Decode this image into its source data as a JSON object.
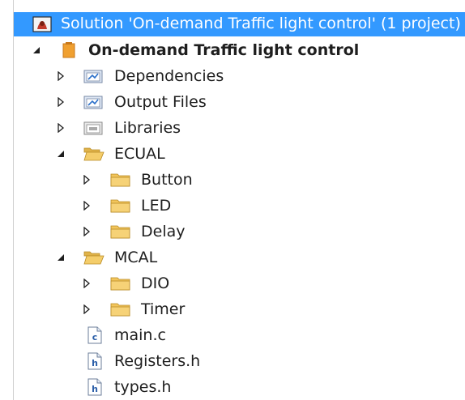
{
  "tree": {
    "solution": {
      "label": "Solution 'On-demand Traffic light control' (1 project)",
      "icon": "solution-icon",
      "selected": true
    },
    "project": {
      "label": "On-demand Traffic light control",
      "icon": "project-icon",
      "expanded": true
    },
    "items": [
      {
        "label": "Dependencies",
        "icon": "reference-folder-icon",
        "expanded": false
      },
      {
        "label": "Output Files",
        "icon": "reference-folder-icon",
        "expanded": false
      },
      {
        "label": "Libraries",
        "icon": "library-folder-icon",
        "expanded": false
      },
      {
        "label": "ECUAL",
        "icon": "folder-open-icon",
        "expanded": true,
        "children": [
          {
            "label": "Button",
            "icon": "folder-icon",
            "expanded": false
          },
          {
            "label": "LED",
            "icon": "folder-icon",
            "expanded": false
          },
          {
            "label": "Delay",
            "icon": "folder-icon",
            "expanded": false
          }
        ]
      },
      {
        "label": "MCAL",
        "icon": "folder-open-icon",
        "expanded": true,
        "children": [
          {
            "label": "DIO",
            "icon": "folder-icon",
            "expanded": false
          },
          {
            "label": "Timer",
            "icon": "folder-icon",
            "expanded": false
          }
        ]
      },
      {
        "label": "main.c",
        "icon": "c-file-icon"
      },
      {
        "label": "Registers.h",
        "icon": "h-file-icon"
      },
      {
        "label": "types.h",
        "icon": "h-file-icon"
      }
    ]
  },
  "colors": {
    "selection": "#3399ff",
    "folder": "#f2c55c",
    "project": "#f0a030"
  }
}
